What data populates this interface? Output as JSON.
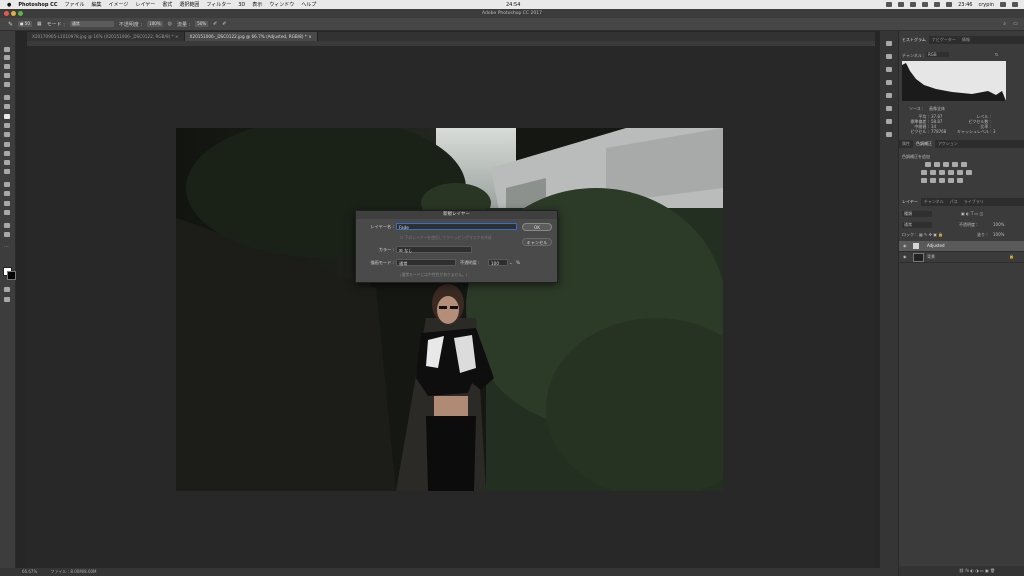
{
  "menubar": {
    "app": "Photoshop CC",
    "items": [
      "ファイル",
      "編集",
      "イメージ",
      "レイヤー",
      "書式",
      "選択範囲",
      "フィルター",
      "3D",
      "表示",
      "ウィンドウ",
      "ヘルプ"
    ],
    "clock_center": "24:54",
    "time": "23:46",
    "user": "crypin"
  },
  "window_title": "Adobe Photoshop CC 2017",
  "options": {
    "mode_label": "モード :",
    "mode_value": "通常",
    "opacity_label": "不透明度 :",
    "opacity_value": "100%",
    "flow_label": "流量 :",
    "flow_value": "50%"
  },
  "tabs": [
    {
      "label": "X20170905-L1010978.jpg @ 16% (X20151006-_DSC0122, RGB/8) *",
      "active": false
    },
    {
      "label": "X20151006-_DSC0122.jpg @ 66.7% (Adjusted, RGB/8) *",
      "active": true
    }
  ],
  "dialog": {
    "title": "新規レイヤー",
    "name_label": "レイヤー名 :",
    "name_value": "Fade",
    "clip_option": "下のレイヤーを使用してクリッピングマスクを作成",
    "color_label": "カラー :",
    "color_value": "なし",
    "blend_label": "描画モード :",
    "blend_value": "通常",
    "opacity_label": "不透明度 :",
    "opacity_value": "100",
    "opacity_unit": "%",
    "note": "(通常モードには中性色がありません。)",
    "ok": "OK",
    "cancel": "キャンセル"
  },
  "status": {
    "zoom": "66.67%",
    "doc": "ファイル : 8.00M/8.00M"
  },
  "histogram": {
    "tabs": [
      "ヒストグラム",
      "ナビゲーター",
      "情報"
    ],
    "channel_label": "チャンネル :",
    "channel_value": "RGB",
    "source_label": "ソース :",
    "source_value": "画像全体",
    "stats_left": [
      "平均 :",
      "標準偏差 :",
      "中間値 :",
      "ピクセル :"
    ],
    "stats_left_vals": [
      "37.87",
      "58.87",
      "14",
      "778768"
    ],
    "stats_right": [
      "レベル :",
      "ピクセル数 :",
      "比率 :",
      "キャッシュレベル :"
    ],
    "stats_right_vals": [
      "",
      "",
      "",
      "3"
    ]
  },
  "adjust": {
    "tabs": [
      "属性",
      "色調補正",
      "アクション"
    ],
    "hint": "色調補正を追加"
  },
  "layers": {
    "tabs": [
      "レイヤー",
      "チャンネル",
      "パス",
      "ライブラリ"
    ],
    "search": "種類",
    "blend": "通常",
    "opacity_label": "不透明度 :",
    "opacity_value": "100%",
    "lock_label": "ロック :",
    "fill_label": "塗り :",
    "fill_value": "100%",
    "items": [
      {
        "name": "Adjusted",
        "selected": true
      },
      {
        "name": "背景",
        "selected": false
      }
    ]
  },
  "colors": {
    "accent": "#2f6fcf",
    "panel": "#3b3b3b",
    "dialog": "#4a4a4a"
  }
}
